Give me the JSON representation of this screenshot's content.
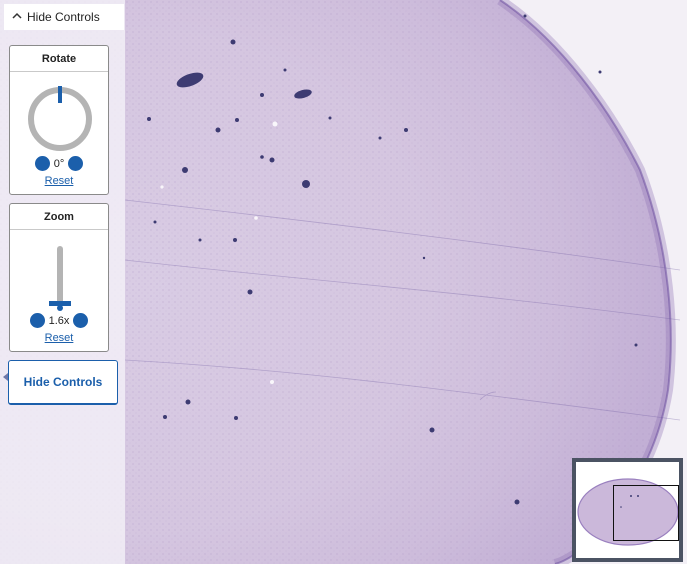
{
  "toggle": {
    "label": "Hide Controls",
    "icon": "chevron-up-icon"
  },
  "rotate": {
    "title": "Rotate",
    "value": "0°",
    "reset_label": "Reset"
  },
  "zoom": {
    "title": "Zoom",
    "value": "1.6x",
    "reset_label": "Reset",
    "level_fraction": 0.1
  },
  "hide_controls_button": {
    "label": "Hide Controls"
  },
  "colors": {
    "accent": "#1b5fab",
    "tissue": "#d8c8e2",
    "stain_dark": "#3d3b72",
    "navigator_bg": "#4b5363"
  },
  "icons": [
    "chevron-up-icon",
    "rotate-dial-icon",
    "zoom-slider-icon",
    "navigator-thumbnail"
  ]
}
